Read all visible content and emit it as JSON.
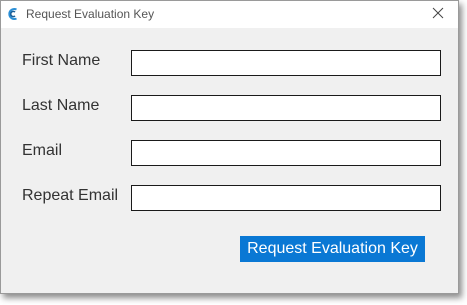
{
  "window": {
    "title": "Request Evaluation Key",
    "close_icon": "close-icon",
    "app_icon": "app-logo-icon"
  },
  "form": {
    "fields": [
      {
        "label": "First Name",
        "value": "",
        "placeholder": ""
      },
      {
        "label": "Last Name",
        "value": "",
        "placeholder": ""
      },
      {
        "label": "Email",
        "value": "",
        "placeholder": ""
      },
      {
        "label": "Repeat Email",
        "value": "",
        "placeholder": ""
      }
    ],
    "submit_label": "Request Evaluation Key"
  },
  "colors": {
    "accent": "#0a78d4",
    "dialog_background": "#f0f0f0",
    "titlebar_background": "#ffffff"
  }
}
